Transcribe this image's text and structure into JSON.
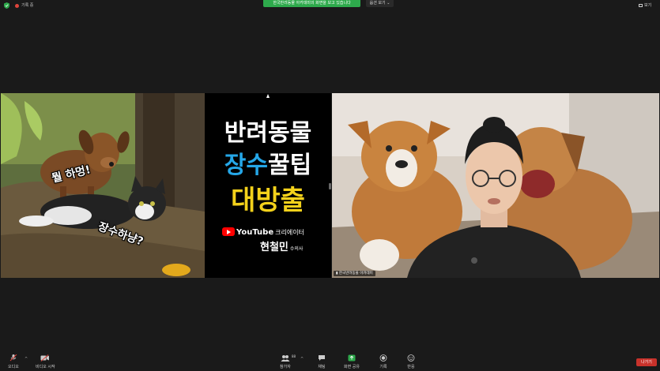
{
  "topbar": {
    "recording_label": "기록 중",
    "share_banner": "한국반려동물 아카데미의 화면을 보고 있습니다",
    "view_options": "옵션 보기",
    "view_button": "보기"
  },
  "slide": {
    "speech_1": "뭘 하멍!",
    "speech_2": "장수하냥?",
    "title_line1": "반려동물",
    "title_line2_a": "장수",
    "title_line2_b": "꿀팁",
    "title_line3": "대방출",
    "youtube_word": "YouTube",
    "creator_label": "크리에이터",
    "presenter_name": "현철민",
    "presenter_role": "수의사"
  },
  "webcam": {
    "participant_name": "한국반려동물 아카데미"
  },
  "controls": {
    "audio": "오디오",
    "video": "비디오 시작",
    "participants": "참가자",
    "participants_count": "88",
    "chat": "채팅",
    "share_screen": "화면 공유",
    "record": "기록",
    "reactions": "반응",
    "leave": "나가기"
  },
  "colors": {
    "share_green": "#2eaa4c",
    "leave_red": "#c8322b",
    "title_blue": "#25a7e8",
    "title_yellow": "#f3d11b",
    "background": "#1a1a1a"
  }
}
